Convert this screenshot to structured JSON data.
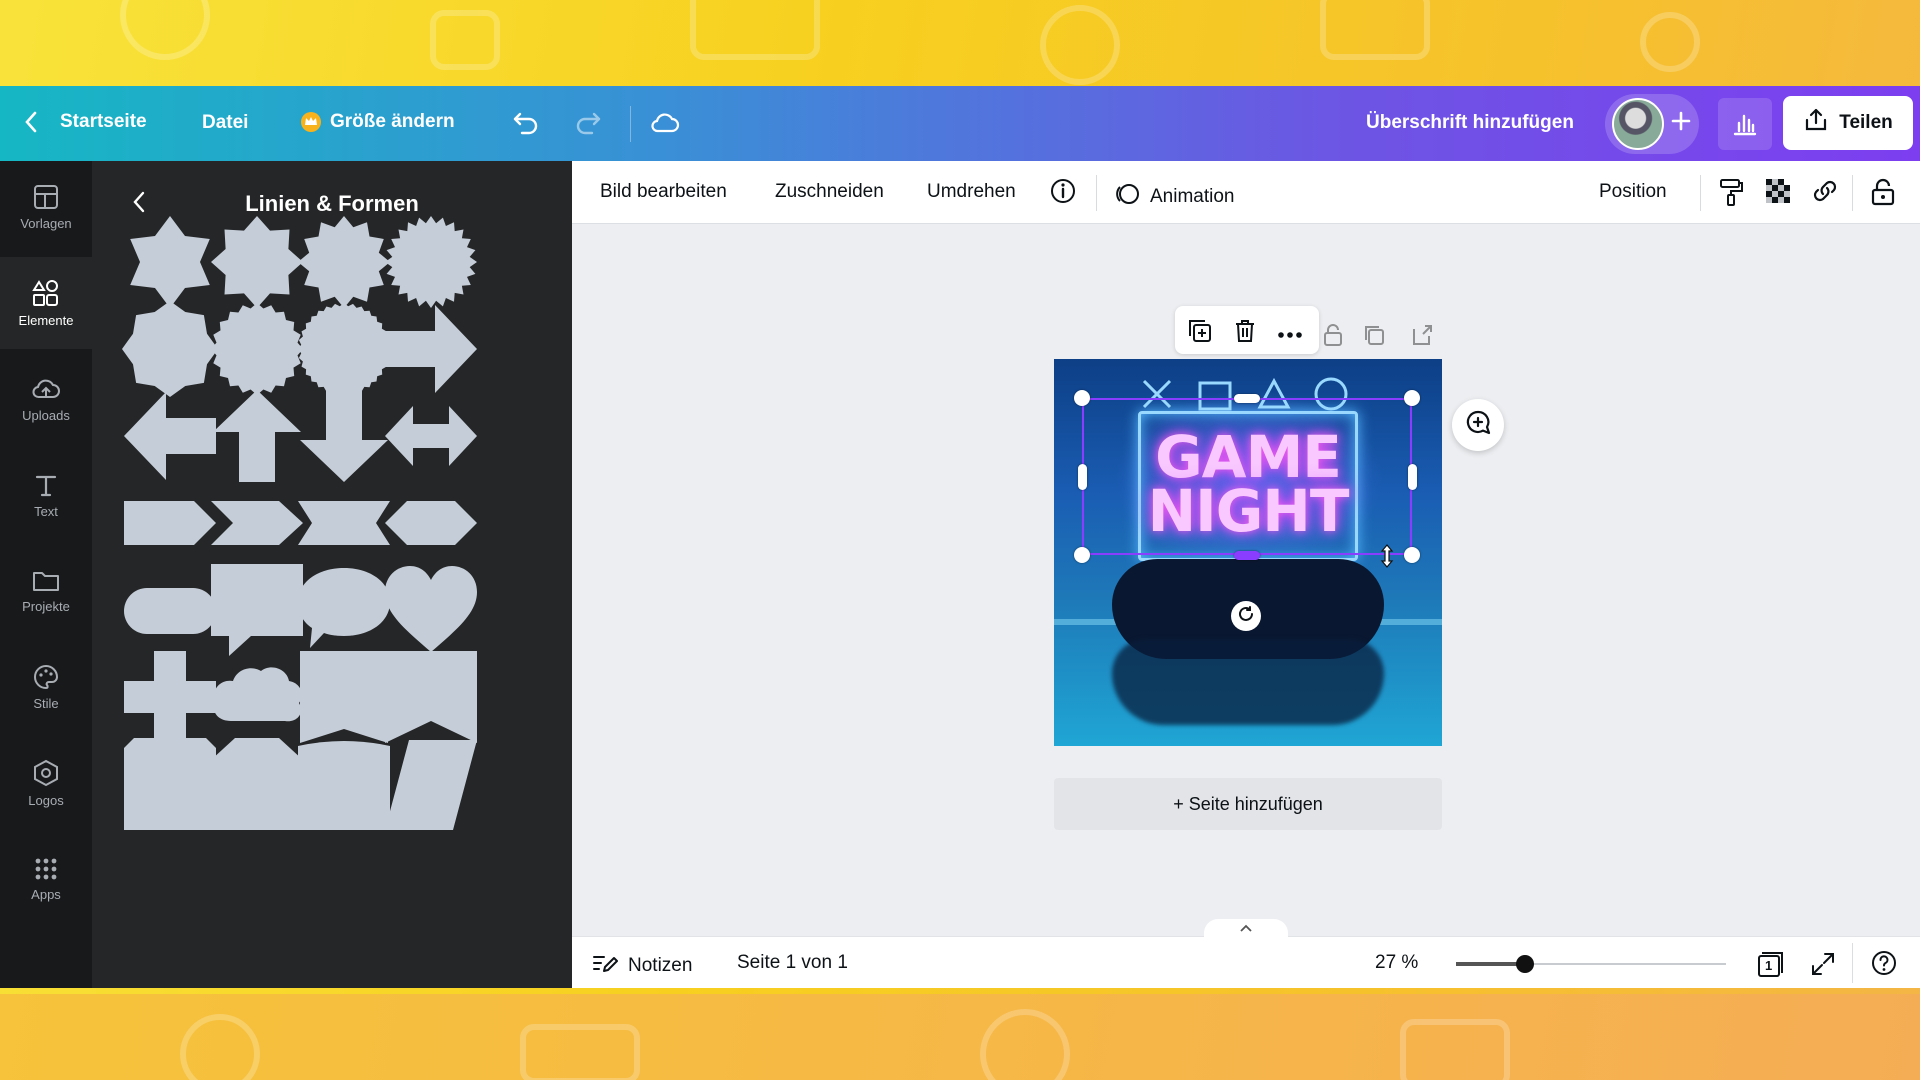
{
  "topbar": {
    "home_label": "Startseite",
    "file_label": "Datei",
    "resize_label": "Größe ändern",
    "design_title": "Überschrift hinzufügen",
    "share_label": "Teilen"
  },
  "rail": {
    "items": [
      {
        "label": "Vorlagen"
      },
      {
        "label": "Elemente"
      },
      {
        "label": "Uploads"
      },
      {
        "label": "Text"
      },
      {
        "label": "Projekte"
      },
      {
        "label": "Stile"
      },
      {
        "label": "Logos"
      },
      {
        "label": "Apps"
      }
    ],
    "active": "Elemente"
  },
  "panel": {
    "title": "Linien & Formen"
  },
  "context_toolbar": {
    "edit_image": "Bild bearbeiten",
    "crop": "Zuschneiden",
    "flip": "Umdrehen",
    "animation": "Animation",
    "position": "Position"
  },
  "canvas": {
    "title_line1": "GAME",
    "title_line2": "NIGHT",
    "add_page": "+ Seite hinzufügen"
  },
  "bottom_bar": {
    "notes": "Notizen",
    "page_indicator": "Seite 1 von 1",
    "zoom": "27 %",
    "zoom_fraction": 0.27,
    "page_count_badge": "1"
  },
  "colors": {
    "selection": "#8b3dff",
    "rail_bg": "#18191b",
    "panel_bg": "#252627",
    "shape_fill": "#c5cdd8"
  }
}
